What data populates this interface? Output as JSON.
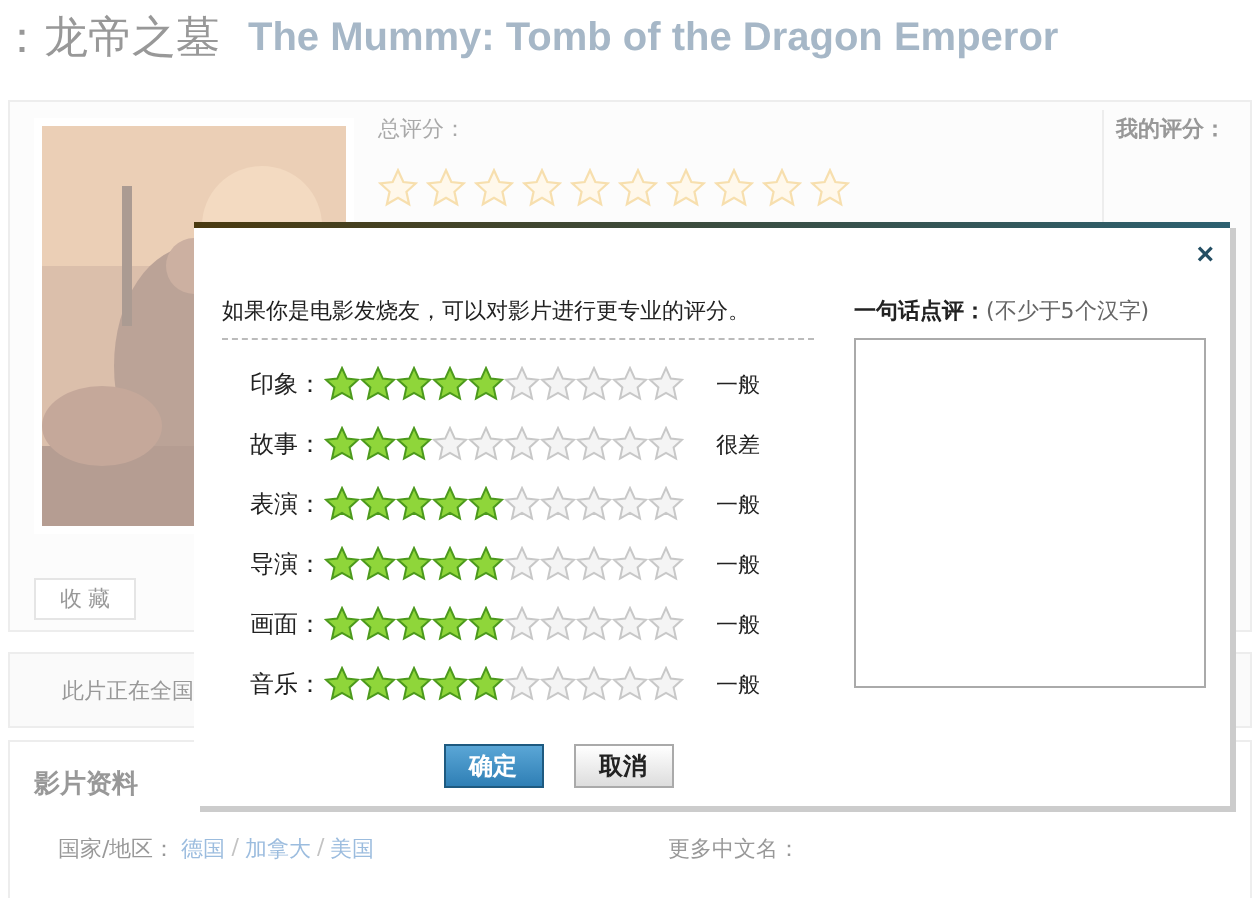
{
  "page": {
    "title_cn": "：龙帝之墓",
    "title_en": "The Mummy: Tomb of the Dragon Emperor",
    "overall_label": "总评分：",
    "my_rating_label": "我的评分：",
    "favorite_button": "收 藏",
    "notice": "此片正在全国",
    "section_title": "影片资料",
    "country_label": "国家/地区：",
    "countries": [
      "德国",
      "加拿大",
      "美国"
    ],
    "country_separator": "/",
    "more_names_label": "更多中文名："
  },
  "dialog": {
    "close": "×",
    "intro": "如果你是电影发烧友，可以对影片进行更专业的评分。",
    "ratings": [
      {
        "label": "印象：",
        "stars": 5,
        "verdict": "一般"
      },
      {
        "label": "故事：",
        "stars": 3,
        "verdict": "很差"
      },
      {
        "label": "表演：",
        "stars": 5,
        "verdict": "一般"
      },
      {
        "label": "导演：",
        "stars": 5,
        "verdict": "一般"
      },
      {
        "label": "画面：",
        "stars": 5,
        "verdict": "一般"
      },
      {
        "label": "音乐：",
        "stars": 5,
        "verdict": "一般"
      }
    ],
    "comment_label": "一句话点评：",
    "comment_hint": "(不少于5个汉字)",
    "buttons": [
      {
        "label": "确定",
        "kind": "primary"
      },
      {
        "label": "取消",
        "kind": "secondary"
      }
    ]
  }
}
